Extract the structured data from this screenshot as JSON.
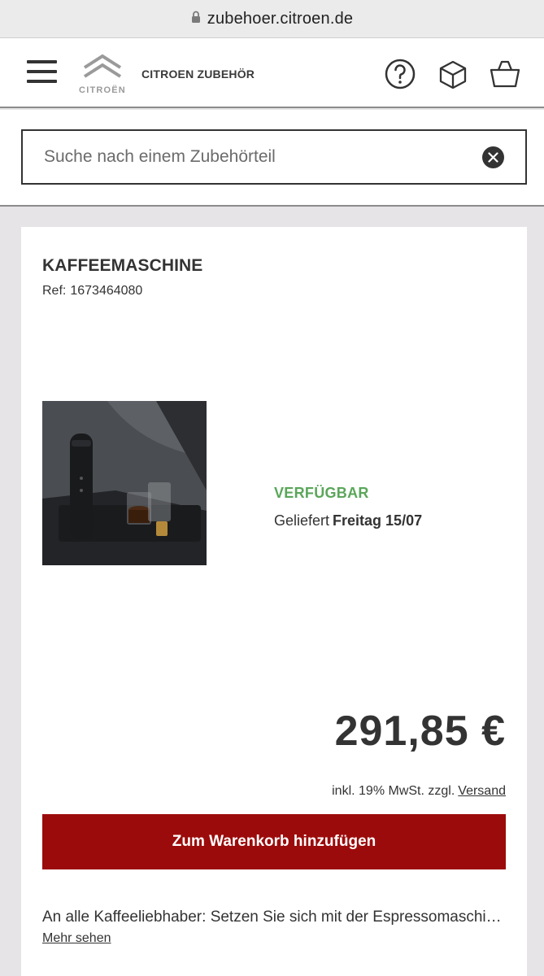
{
  "browser": {
    "url": "zubehoer.citroen.de",
    "lock_icon": "lock-icon"
  },
  "header": {
    "logo_text": "CITROËN",
    "title": "CITROEN ZUBEHÖR",
    "icons": [
      "menu-icon",
      "help-icon",
      "box-icon",
      "basket-icon"
    ]
  },
  "search": {
    "placeholder": "Suche nach einem Zubehörteil",
    "value": "",
    "clear_icon": "close-icon"
  },
  "product": {
    "name": "KAFFEEMASCHINE",
    "ref_label": "Ref:",
    "ref_number": "1673464080",
    "availability": "VERFÜGBAR",
    "delivery_label": "Geliefert",
    "delivery_date": "Freitag 15/07",
    "price": "291,85 €",
    "tax_note": "inkl. 19% MwSt. zzgl.",
    "shipping_link": "Versand",
    "cart_button": "Zum Warenkorb hinzufügen",
    "description": "An alle Kaffeeliebhaber: Setzen Sie sich mit der Espressomaschi…",
    "more_link": "Mehr sehen"
  },
  "colors": {
    "available": "#5aa65a",
    "cart_button": "#9c0b0b",
    "text": "#333333"
  }
}
